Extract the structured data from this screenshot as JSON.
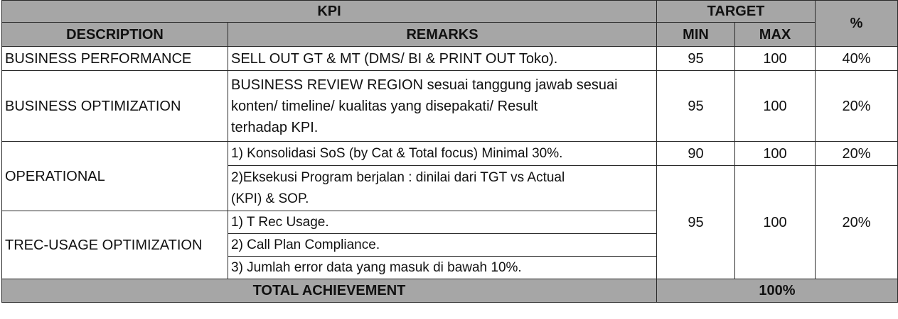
{
  "header": {
    "kpi": "KPI",
    "target": "TARGET",
    "percent": "%",
    "description": "DESCRIPTION",
    "remarks": "REMARKS",
    "min": "MIN",
    "max": "MAX"
  },
  "rows": {
    "business_performance": {
      "description": "BUSINESS PERFORMANCE",
      "remark": "SELL OUT GT & MT (DMS/ BI & PRINT OUT Toko).",
      "min": "95",
      "max": "100",
      "percent": "40%"
    },
    "business_optimization": {
      "description": "BUSINESS OPTIMIZATION",
      "remark_lines": [
        "BUSINESS REVIEW REGION sesuai tanggung jawab sesuai",
        "konten/ timeline/ kualitas yang disepakati/ Result",
        "terhadap KPI."
      ],
      "min": "95",
      "max": "100",
      "percent": "20%"
    },
    "operational": {
      "description": "OPERATIONAL",
      "remark_1": "1) Konsolidasi SoS (by Cat & Total focus) Minimal 30%.",
      "min_1": "90",
      "max_1": "100",
      "percent_1": "20%",
      "remark_2_lines": [
        "2)Eksekusi Program berjalan : dinilai dari TGT vs Actual",
        "(KPI) & SOP."
      ]
    },
    "trec_usage": {
      "description": "TREC-USAGE OPTIMIZATION",
      "remarks": [
        "1) T Rec Usage.",
        "2) Call Plan Compliance.",
        "3) Jumlah error data yang masuk di bawah 10%."
      ]
    },
    "shared_target": {
      "min": "95",
      "max": "100",
      "percent": "20%"
    }
  },
  "footer": {
    "label": "TOTAL ACHIEVEMENT",
    "value": "100%"
  },
  "colors": {
    "header_fill": "#a6a6a6",
    "border": "#2a2a2a"
  }
}
